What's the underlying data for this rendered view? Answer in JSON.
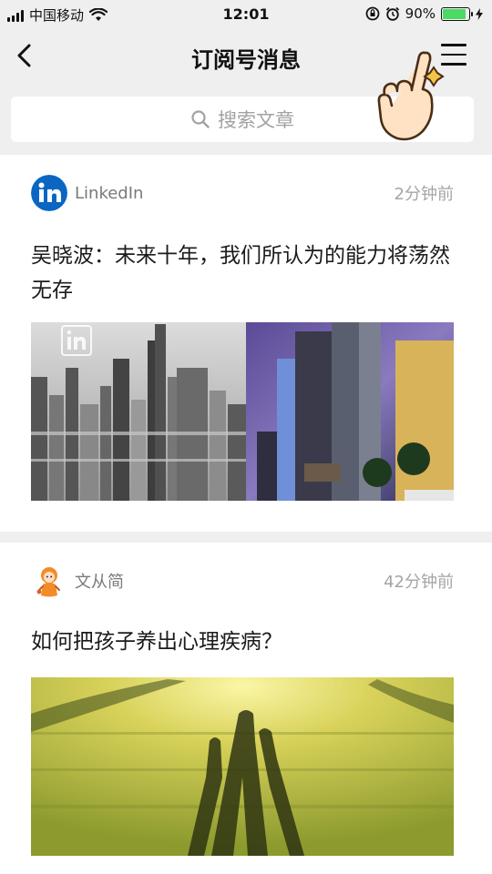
{
  "status_bar": {
    "carrier": "中国移动",
    "time": "12:01",
    "battery_percent": "90%",
    "battery_level": 0.9
  },
  "nav": {
    "title": "订阅号消息",
    "back_icon": "chevron-left-icon",
    "menu_icon": "hamburger-menu-icon"
  },
  "search": {
    "placeholder": "搜索文章"
  },
  "articles": [
    {
      "account": "LinkedIn",
      "time": "2分钟前",
      "title": "吴晓波：未来十年，我们所认为的能力将荡然无存",
      "image": "city-skyline-photo"
    },
    {
      "account": "文从简",
      "time": "42分钟前",
      "title": "如何把孩子养出心理疾病？",
      "image": "family-shadows-on-grass-photo"
    }
  ],
  "colors": {
    "background": "#efefef",
    "linkedin_blue": "#0a66c2",
    "battery_green": "#4cd964",
    "secondary_text": "#a5a5a5"
  }
}
